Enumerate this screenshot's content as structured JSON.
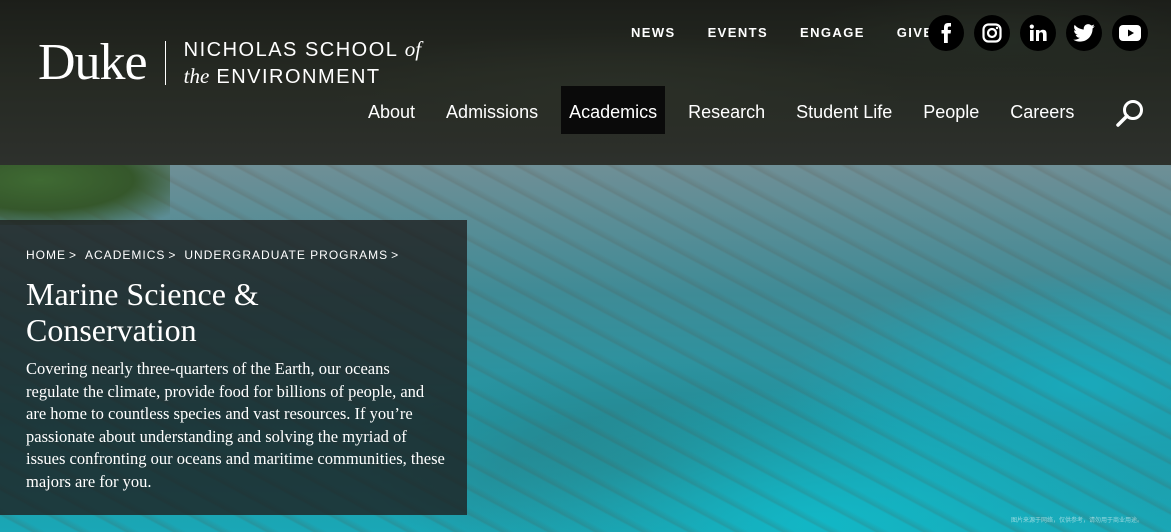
{
  "logo": {
    "duke": "Duke",
    "line1_text": "NICHOLAS SCHOOL",
    "line1_italic": "of",
    "line2_italic": "the",
    "line2_text": "ENVIRONMENT"
  },
  "utility_nav": [
    "NEWS",
    "EVENTS",
    "ENGAGE",
    "GIVE"
  ],
  "social": [
    {
      "icon": "facebook-icon"
    },
    {
      "icon": "instagram-icon"
    },
    {
      "icon": "linkedin-icon"
    },
    {
      "icon": "twitter-icon"
    },
    {
      "icon": "youtube-icon"
    }
  ],
  "main_nav": {
    "items": [
      "About",
      "Admissions",
      "Academics",
      "Research",
      "Student Life",
      "People",
      "Careers"
    ],
    "active": "Academics"
  },
  "breadcrumb": [
    "HOME",
    "ACADEMICS",
    "UNDERGRADUATE PROGRAMS"
  ],
  "breadcrumb_separator": ">",
  "hero": {
    "title": "Marine Science & Conservation",
    "text": "Covering nearly three-quarters of the Earth, our oceans regulate the climate, provide food for billions of people, and are home to countless species and vast resources. If you’re passionate about understanding and solving the myriad of issues confronting our oceans and maritime communities, these majors are for you."
  },
  "watermark": "图片来源于网络，仅供参考，请勿用于商业用途。",
  "colors": {
    "active_nav_bg": "#0a0a0a",
    "panel_bg": "rgba(30,30,30,0.78)",
    "social_bg": "#000000"
  }
}
